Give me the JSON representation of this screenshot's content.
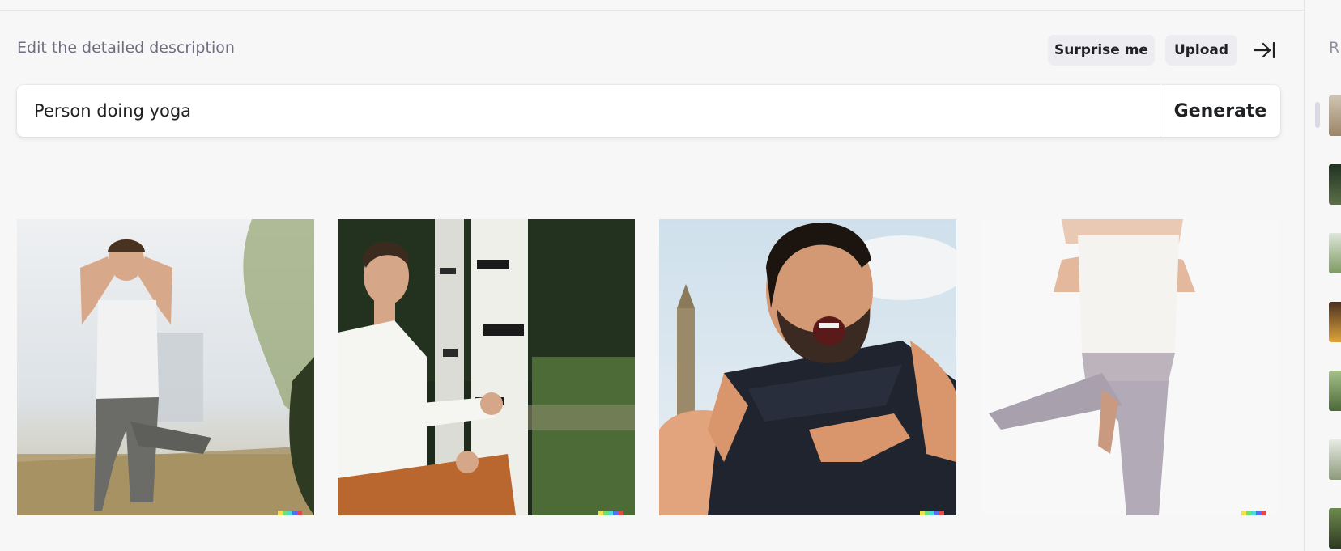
{
  "header": {
    "description_label": "Edit the detailed description",
    "surprise_label": "Surprise me",
    "upload_label": "Upload",
    "collapse_icon": "collapse-right-icon"
  },
  "prompt": {
    "value": "Person doing yoga",
    "placeholder": "",
    "generate_label": "Generate"
  },
  "results": [
    {
      "subject": "man standing in tree pose outdoors, hands behind head"
    },
    {
      "subject": "man in white shirt meditating by birch trees"
    },
    {
      "subject": "bearded man with open mouth, hand gesture, tower in background"
    },
    {
      "subject": "woman in white top and grey pants in tree pose, prayer hands"
    }
  ],
  "sidebar": {
    "heading_letter": "R",
    "thumbnail_count": 7
  },
  "colors": {
    "background": "#f7f7f8",
    "pill": "#ececf1",
    "text": "#202123",
    "muted": "#6e6e80"
  }
}
